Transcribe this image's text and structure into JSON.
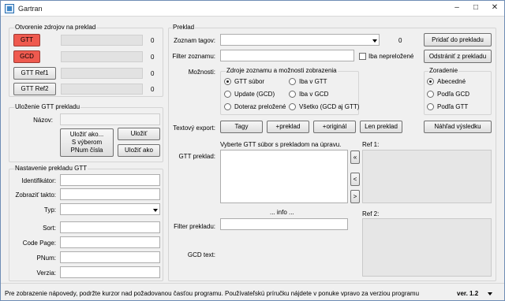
{
  "window": {
    "title": "Gartran"
  },
  "sources": {
    "title": "Otvorenie zdrojov na preklad",
    "rows": [
      {
        "label": "GTT",
        "count": "0"
      },
      {
        "label": "GCD",
        "count": "0"
      },
      {
        "label": "GTT Ref1",
        "count": "0"
      },
      {
        "label": "GTT Ref2",
        "count": "0"
      }
    ]
  },
  "save": {
    "title": "Uloženie GTT prekladu",
    "name_label": "Názov:",
    "save_as_selected": "Uložiť ako...\nS výberom\nPNum čísla",
    "save": "Uložiť",
    "save_as": "Uložiť ako"
  },
  "settings": {
    "title": "Nastavenie prekladu GTT",
    "fields": [
      {
        "label": "Identifikátor:"
      },
      {
        "label": "Zobraziť takto:"
      },
      {
        "label": "Typ:"
      },
      {
        "label": "Sort:"
      },
      {
        "label": "Code Page:"
      },
      {
        "label": "PNum:"
      },
      {
        "label": "Verzia:"
      }
    ]
  },
  "preklad": {
    "title": "Preklad",
    "tags_label": "Zoznam tagov:",
    "tags_count": "0",
    "filter_label": "Filter zoznamu:",
    "untranslated_label": "Iba nepreložené",
    "add_button": "Pridať do prekladu",
    "remove_button": "Odstrániť z prekladu",
    "options_label": "Možnosti:",
    "sources_group": "Zdroje zoznamu a možnosti zobrazenia",
    "radios": [
      {
        "label": "GTT súbor",
        "on": true
      },
      {
        "label": "Iba v GTT",
        "on": false
      },
      {
        "label": "Update (GCD)",
        "on": false
      },
      {
        "label": "Iba v GCD",
        "on": false
      },
      {
        "label": "Doteraz preložené",
        "on": false
      },
      {
        "label": "Všetko (GCD aj GTT)",
        "on": false
      }
    ],
    "sort_group": "Zoradenie",
    "sort_radios": [
      {
        "label": "Abecedné",
        "on": true
      },
      {
        "label": "Podľa GCD",
        "on": false
      },
      {
        "label": "Podľa GTT",
        "on": false
      }
    ],
    "export_label": "Textový export:",
    "export_buttons": [
      "Tagy",
      "+preklad",
      "+originál",
      "Len preklad"
    ],
    "preview_button": "Náhľad výsledku",
    "hint": "Vyberte GTT súbor s prekladom na úpravu.",
    "gtt_label": "GTT preklad:",
    "ref1_label": "Ref 1:",
    "ref2_label": "Ref 2:",
    "nav_buttons": [
      "«",
      "<",
      ">"
    ],
    "info": "... info ...",
    "filter_preklad_label": "Filter prekladu:",
    "gcd_label": "GCD text:"
  },
  "status": {
    "text": "Pre zobrazenie nápovedy, podržte kurzor nad požadovanou časťou programu. Používateľskú príručku nájdete v ponuke vpravo za verziou programu",
    "version": "ver. 1.2"
  }
}
